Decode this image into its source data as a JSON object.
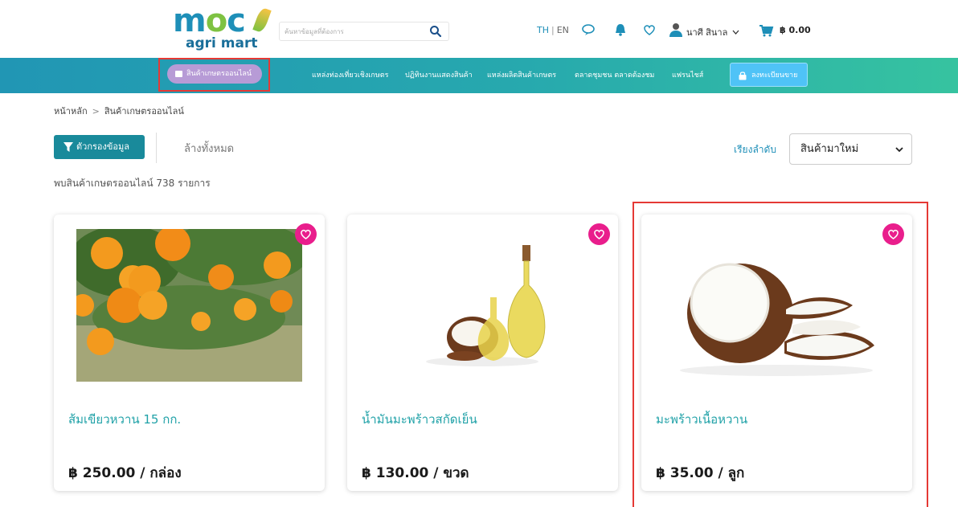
{
  "header": {
    "logo_top": "moc",
    "logo_bottom": "agri mart",
    "search_placeholder": "ค้นหาข้อมูลที่ต้องการ",
    "lang_th": "TH",
    "lang_sep": "|",
    "lang_en": "EN",
    "user_name": "นาศี สินาล",
    "cart_total": "฿ 0.00"
  },
  "nav": {
    "items": [
      {
        "label": "สินค้าเกษตรออนไลน์"
      },
      {
        "label": "แหล่งท่องเที่ยวเชิงเกษตร"
      },
      {
        "label": "ปฏิทินงานแสดงสินค้า"
      },
      {
        "label": "แหล่งผลิตสินค้าเกษตร"
      },
      {
        "label": "ตลาดชุมชน ตลาดต้องชม"
      },
      {
        "label": "แฟรนไชส์"
      }
    ],
    "register_label": "ลงทะเบียนขาย"
  },
  "breadcrumb": {
    "home": "หน้าหลัก",
    "sep": ">",
    "current": "สินค้าเกษตรออนไลน์"
  },
  "filters": {
    "filter_label": "ตัวกรองข้อมูล",
    "clear_label": "ล้างทั้งหมด",
    "sort_label": "เรียงลำดับ",
    "sort_selected": "สินค้ามาใหม่"
  },
  "results": {
    "count_text": "พบสินค้าเกษตรออนไลน์ 738 รายการ"
  },
  "products": [
    {
      "name": "ส้มเขียวหวาน 15 กก.",
      "price": "฿ 250.00 / กล่อง"
    },
    {
      "name": "น้ำมันมะพร้าวสกัดเย็น",
      "price": "฿ 130.00 / ขวด"
    },
    {
      "name": "มะพร้าวเนื้อหวาน",
      "price": "฿ 35.00 / ลูก"
    }
  ],
  "colors": {
    "accent": "#21a2a8",
    "favorite": "#e91e8c",
    "nav_start": "#2196b4",
    "nav_end": "#36c3a0",
    "highlight": "#e53935"
  },
  "icons": [
    "search-icon",
    "chat-icon",
    "bell-icon",
    "heart-icon",
    "user-icon",
    "chevron-down-icon",
    "cart-icon",
    "grid-icon",
    "lock-icon",
    "funnel-icon"
  ]
}
